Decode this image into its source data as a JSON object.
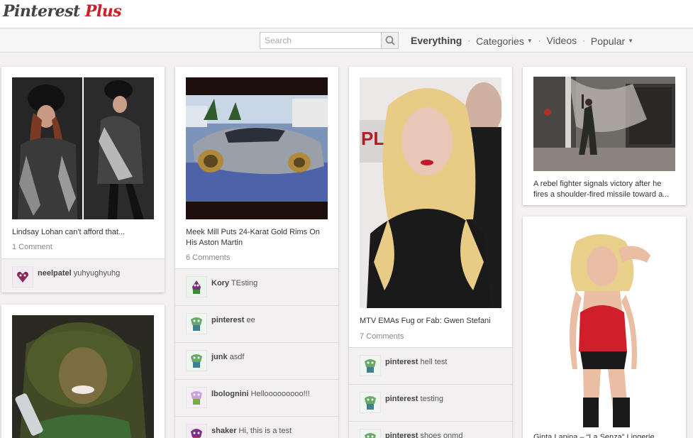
{
  "header": {
    "logo_part1": "Pinterest",
    "logo_part2": "Plus"
  },
  "search": {
    "placeholder": "Search"
  },
  "nav": {
    "everything": "Everything",
    "categories": "Categories",
    "videos": "Videos",
    "popular": "Popular",
    "separator": "·"
  },
  "pins": [
    {
      "description": "Lindsay Lohan can't afford that...",
      "count": "1 Comment",
      "comments": [
        {
          "user": "neelpatel",
          "text": "yuhyughyuhg"
        }
      ]
    },
    {
      "description": "Meek Mill Puts 24-Karat Gold Rims On His Aston Martin",
      "count": "6 Comments",
      "comments": [
        {
          "user": "Kory",
          "text": "TEsting"
        },
        {
          "user": "pinterest",
          "text": "ee"
        },
        {
          "user": "junk",
          "text": "asdf"
        },
        {
          "user": "lbolognini",
          "text": "Hellooooooooo!!!"
        },
        {
          "user": "shaker",
          "text": "Hi, this is a test"
        }
      ]
    },
    {
      "description": "MTV EMAs Fug or Fab: Gwen Stefani",
      "count": "7 Comments",
      "comments": [
        {
          "user": "pinterest",
          "text": "hell test"
        },
        {
          "user": "pinterest",
          "text": "testing"
        },
        {
          "user": "pinterest",
          "text": "shoes onmd"
        }
      ]
    },
    {
      "description": "A rebel fighter signals victory after he fires a shoulder-fired missile toward a..."
    },
    {
      "description": "Ginta Lapina – “La Senza” Lingerie"
    },
    {
      "description": ""
    }
  ]
}
